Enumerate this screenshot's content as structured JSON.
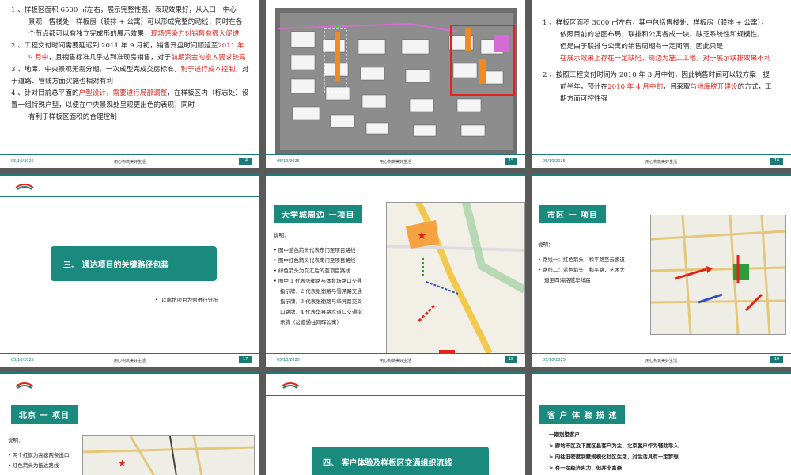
{
  "footer_date": "05/10/2025",
  "footer_slogan": "用心构筑美好生活",
  "logo_text": "CIFI GROUP",
  "slide14": {
    "page": "14",
    "lines": [
      "1 、样板区面积 6500 ㎡左右，展示完整性强，表现效果好，从入口一中心",
      "景观一售楼处一样板房（联排 + 公寓）可以形成完整的动线，同时在各",
      "个节点都可以有独立完成形的展示效果，",
      "现场感染力对销售有很大促进",
      "2 、工程交付时间需要延迟到 2011 年 9 月初，销售开盘时间顺延至",
      "2011 年",
      "9 月中",
      "，且销售标准几乎达到准现房销售，对于",
      "前期资金的投入要求较高",
      "3 、地库、中央景观无需分期，一次成型完成交房标准，",
      "利于进行成本控制",
      "，对于道路、管线方面实施也相对有利",
      "4 、针对目前总平面的",
      "户型设计，需要进行局部调整",
      "，在样板区内（标志处）设置一组特殊户型，以便在中央景观处呈现更出色的表现，同时",
      "有利于样板区面积的合理控制"
    ]
  },
  "slide15": {
    "page": "15"
  },
  "slide16": {
    "page": "16",
    "lines": [
      "1 、样板区面积 3000 ㎡左右，其中包括售楼处、样板房（联排 + 公寓），",
      "依照目前的总图布局，联排和公寓各成一块，缺乏系统性和规模性，",
      "但是由于联排与公寓的销售周期有一定间隔，因此只是",
      "在展示效果上存在一定缺陷，周边为施工工地，对于展示联排效果不利",
      "2 、按照工程交付时间为 2010 年 3 月中旬，因此销售时间可以较方案一提",
      "前半年，预计在",
      "2010 年 4 月中旬",
      "，且采取",
      "与地库脱开建设",
      "的方式，工",
      "期方面可控性强"
    ]
  },
  "slide17": {
    "page": "17",
    "panel_title": "三、 通达项目的关键路径包装",
    "note": "以廊坊项目为例进行分析"
  },
  "slide18": {
    "page": "18",
    "badge": "大学城周边 一项目",
    "caption": "说明：",
    "items": [
      "图中蓝色箭头代表东门至项目路线",
      "图中红色箭头代表南门至项目路线",
      "绿色箭头为交汇后的至项目路线",
      "图中 1 代表张衡路与体育场路口交通",
      "指示牌，2 代表张衡路与雪芹路交通",
      "指示牌，3 代表张衡路与华昇路交叉",
      "口路牌，4 代表华昇路岔道口交通指",
      "示牌（岔道通往同晖公寓）"
    ]
  },
  "slide19": {
    "page": "19",
    "badge": "市区 一 项目",
    "caption": "说明：",
    "items": [
      "路线一：红色箭头，和平路至云鹏道",
      "路线二：蓝色箭头，和平路，艺术大",
      "道至四海路或华祥路"
    ]
  },
  "slide20": {
    "badge": "北京 一 项目",
    "caption": "说明：",
    "items": [
      "两个红旗为高速两条出口",
      "红色箭头为抵达路线"
    ]
  },
  "slide21": {
    "panel_title": "四、 客户体验及样板区交通组织流线"
  },
  "slide22": {
    "badge": "客 户 体 验 描 述",
    "heading": "一期别墅客户：",
    "items": [
      "廊坊市区及下属区县客户为主，北京客户作为辅助导入",
      "向往低密度别墅规模化社区生活，对生活具有一定梦想",
      "有一定经济实力，但并非富豪"
    ]
  },
  "colors": {
    "teal": "#1b8a7e",
    "red": "#e2231a",
    "orange": "#f08a24"
  }
}
